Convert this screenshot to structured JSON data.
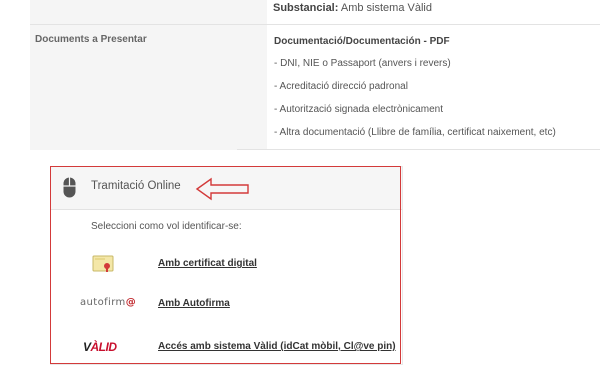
{
  "info": {
    "substancial_label": "Substancial:",
    "substancial_value": "Amb sistema Vàlid",
    "docs_label": "Documents a Presentar",
    "docs_title": "Documentació/Documentación - PDF",
    "docs": [
      "- DNI, NIE o Passaport (anvers i revers)",
      "- Acreditació direcció padronal",
      "- Autorització signada electrònicament",
      "- Altra documentació (Llibre de família, certificat naixement, etc)"
    ]
  },
  "online": {
    "title": "Tramitació Online",
    "prompt": "Seleccioni como vol identificar-se:",
    "options": [
      {
        "label": "Amb certificat digital",
        "icon": "certificate-icon"
      },
      {
        "label": "Amb Autofirma",
        "icon": "autofirma-logo",
        "logo_text": "autofirm",
        "logo_at": "@"
      },
      {
        "label": "Accés amb sistema Vàlid (idCat mòbil, Cl@ve pin)",
        "icon": "valid-logo",
        "logo_v": "V",
        "logo_rest": "ÀLID"
      }
    ]
  },
  "colors": {
    "annotation_red": "#d33a3a",
    "valid_red": "#c8102e"
  }
}
